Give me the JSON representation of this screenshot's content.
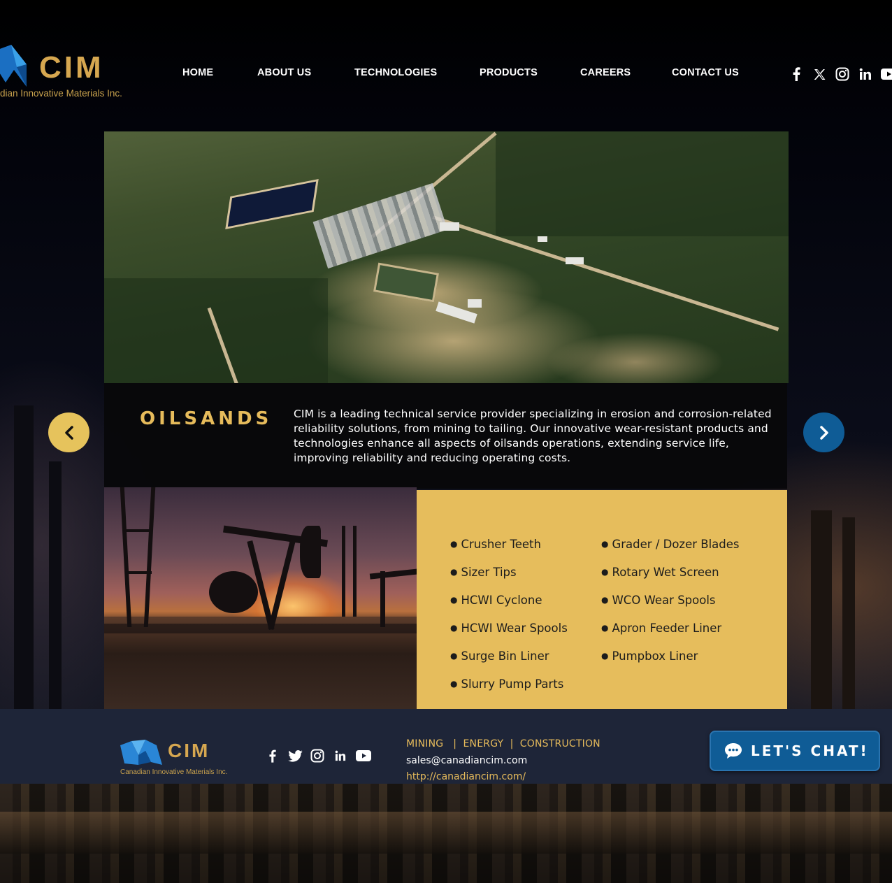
{
  "header": {
    "logo": {
      "word": "CIM",
      "tagline": "dian Innovative Materials Inc."
    },
    "nav": [
      {
        "label": "HOME"
      },
      {
        "label": "ABOUT US"
      },
      {
        "label": "TECHNOLOGIES"
      },
      {
        "label": "PRODUCTS"
      },
      {
        "label": "CAREERS"
      },
      {
        "label": "CONTACT US"
      }
    ],
    "social_icons": [
      "facebook-icon",
      "x-twitter-icon",
      "instagram-icon",
      "linkedin-icon",
      "youtube-icon"
    ]
  },
  "slide": {
    "title": "OILSANDS",
    "description": "CIM is a leading technical service provider specializing in erosion and corrosion-related reliability solutions, from mining to tailing. Our innovative wear-resistant products and technologies enhance all aspects of oilsands operations, extending service life, improving reliability and reducing operating costs.",
    "products_col1": [
      "Crusher Teeth",
      "Sizer Tips",
      "HCWI Cyclone",
      "HCWI Wear Spools",
      "Surge Bin Liner",
      "Slurry Pump Parts"
    ],
    "products_col2": [
      "Grader / Dozer Blades",
      "Rotary Wet Screen",
      "WCO Wear Spools",
      "Apron Feeder Liner",
      "Pumpbox Liner"
    ]
  },
  "footer": {
    "logo": {
      "word": "CIM",
      "tagline": "Canadian Innovative Materials Inc."
    },
    "social_icons": [
      "facebook-icon",
      "twitter-icon",
      "instagram-icon",
      "linkedin-icon",
      "youtube-icon"
    ],
    "sectors": "MINING   |  ENERGY  |  CONSTRUCTION",
    "email": "sales@canadiancim.com",
    "url": "http://canadiancim.com/"
  },
  "chat": {
    "label": "LET'S CHAT!"
  },
  "colors": {
    "gold": "#e6bb5b",
    "brand_blue": "#0f5c96",
    "product_panel": "#e6bd5c",
    "footer": "#1e2538"
  }
}
